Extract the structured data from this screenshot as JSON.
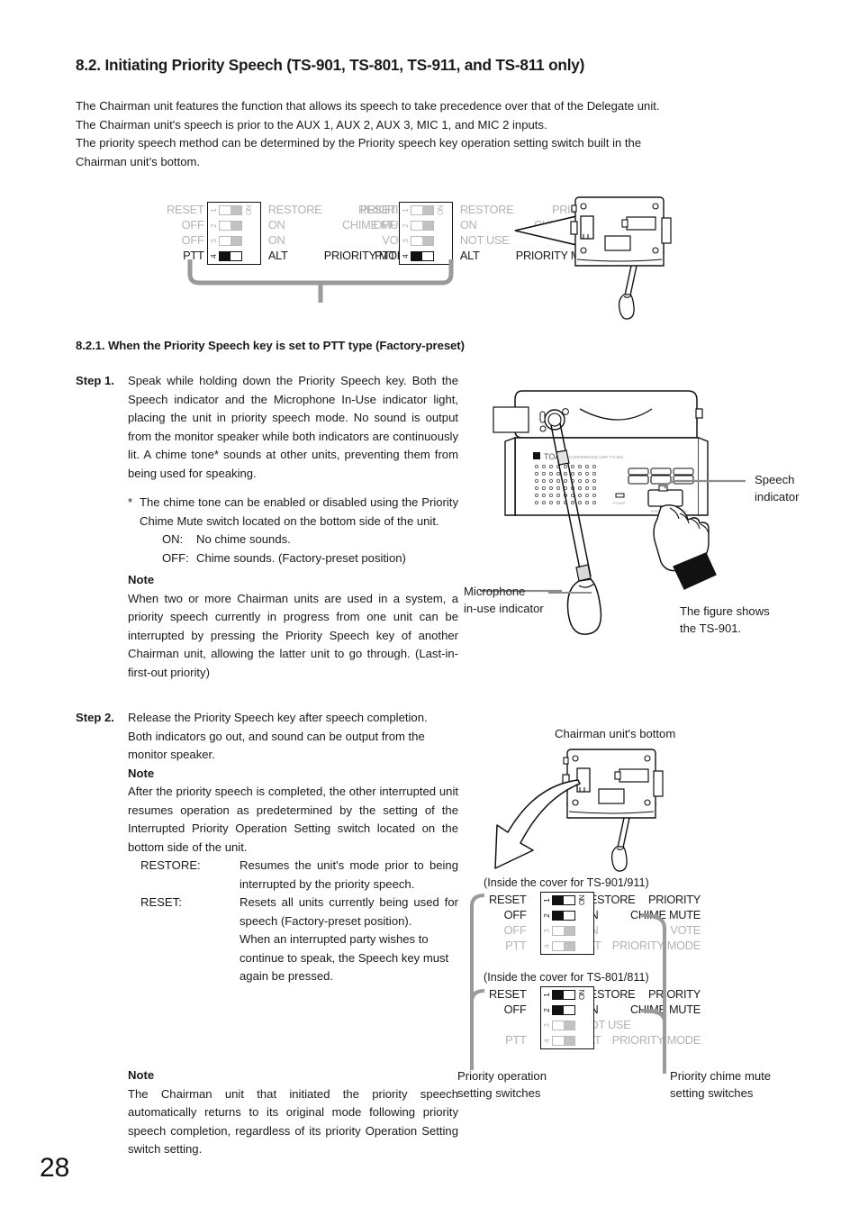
{
  "page": {
    "number": "28"
  },
  "section": {
    "heading": "8.2. Initiating Priority Speech (TS-901, TS-801, TS-911, and TS-811 only)",
    "intro_lines": [
      "The Chairman unit features the function that allows its speech to take precedence over that of the Delegate unit.",
      "The Chairman unit's speech is prior to the AUX 1, AUX 2, AUX 3, MIC 1, and MIC 2 inputs.",
      "The priority speech method can be determined by the Priority speech key operation setting switch built in the",
      "Chairman unit’s bottom."
    ]
  },
  "subsection": {
    "heading": "8.2.1. When the Priority Speech key is set to PTT type (Factory-preset)"
  },
  "step1": {
    "label": "Step 1.",
    "body": "Speak while holding down the Priority Speech key. Both the Speech indicator and the Microphone In-Use indicator light, placing the unit in priority speech mode. No sound is output from the monitor speaker while both indicators are continuously lit. A chime tone* sounds at other units, preventing them from being used for speaking.",
    "footnote_marker": "*",
    "footnote": "The chime tone can be enabled or disabled using the Priority Chime Mute switch located on the bottom side of the unit.",
    "on_key": "ON:",
    "on_value": "No chime sounds.",
    "off_key": "OFF:",
    "off_value": "Chime sounds. (Factory-preset position)",
    "note_heading": "Note",
    "note_body": "When two or more Chairman units are used in a system, a priority speech currently in progress from one unit can be interrupted by pressing the Priority Speech key of another Chairman unit, allowing the latter unit to go through. (Last-in-first-out priority)"
  },
  "step2": {
    "label": "Step 2.",
    "body_line1": "Release the Priority Speech key after speech completion.",
    "body_line2": "Both indicators go out, and sound can be output from the monitor speaker.",
    "note_heading": "Note",
    "note_body": "After the priority speech is completed, the other interrupted unit resumes operation as predetermined by the setting of the Interrupted Priority Operation Setting switch located on the bottom side of the unit.",
    "defs": [
      {
        "key": "RESTORE:",
        "value": "Resumes the unit's mode prior to being interrupted by the priority speech."
      },
      {
        "key": "RESET:",
        "value": "Resets all units currently being used for speech (Factory-preset position)."
      },
      {
        "key": "",
        "value": "When an interrupted party wishes to continue to speak, the Speech key must again be pressed."
      }
    ]
  },
  "final_note": {
    "heading": "Note",
    "body": "The Chairman unit that initiated the priority speech automatically returns to its original mode following priority speech completion, regardless of its priority Operation Setting switch setting."
  },
  "top_figure": {
    "dip_901": {
      "rows": [
        {
          "left": "RESET",
          "right_1": "RESTORE",
          "right_2": "PRIORITY",
          "num": "1",
          "on_label": "ON",
          "position": "right",
          "active": false
        },
        {
          "left": "OFF",
          "right_1": "ON",
          "right_2": "CHIME MUTE",
          "num": "2",
          "on_label": "",
          "position": "right",
          "active": false
        },
        {
          "left": "OFF",
          "right_1": "ON",
          "right_2": "VOTE",
          "num": "3",
          "on_label": "",
          "position": "right",
          "active": false
        },
        {
          "left": "PTT",
          "right_1": "ALT",
          "right_2": "PRIORITY MODE",
          "num": "4",
          "on_label": "",
          "position": "left",
          "active": true
        }
      ]
    },
    "dip_801": {
      "rows": [
        {
          "left": "RESET",
          "right_1": "RESTORE",
          "right_2": "PRIORITY",
          "num": "1",
          "on_label": "ON",
          "position": "right",
          "active": false
        },
        {
          "left": "OFF",
          "right_1": "ON",
          "right_2": "CHIME MUTE",
          "num": "2",
          "on_label": "",
          "position": "right",
          "active": false
        },
        {
          "left": "",
          "right_1": "NOT  USE",
          "right_2": "",
          "num": "3",
          "on_label": "",
          "position": "right",
          "active": false
        },
        {
          "left": "PTT",
          "right_1": "ALT",
          "right_2": "PRIORITY MODE",
          "num": "4",
          "on_label": "",
          "position": "left",
          "active": true
        }
      ]
    }
  },
  "unit_figure": {
    "speech_indicator_label_line1": "Speech",
    "speech_indicator_label_line2": "indicator",
    "mic_label_line1": "Microphone",
    "mic_label_line2": "in-use indicator",
    "caption_line1": "The figure shows",
    "caption_line2": "the TS-901.",
    "brand": "TOA"
  },
  "bottom_figure": {
    "title": "Chairman unit's bottom",
    "cover_901": "(Inside the cover for TS-901/911)",
    "cover_801": "(Inside the cover for TS-801/811)",
    "dip_901": {
      "rows": [
        {
          "left": "RESET",
          "right_1": "RESTORE",
          "right_2": "PRIORITY",
          "num": "1",
          "on_label": "ON",
          "position": "left",
          "active": true
        },
        {
          "left": "OFF",
          "right_1": "ON",
          "right_2": "CHIME MUTE",
          "num": "2",
          "on_label": "",
          "position": "left",
          "active": true
        },
        {
          "left": "OFF",
          "right_1": "ON",
          "right_2": "VOTE",
          "num": "3",
          "on_label": "",
          "position": "right",
          "active": false
        },
        {
          "left": "PTT",
          "right_1": "ALT",
          "right_2": "PRIORITY MODE",
          "num": "4",
          "on_label": "",
          "position": "right",
          "active": false
        }
      ]
    },
    "dip_801": {
      "rows": [
        {
          "left": "RESET",
          "right_1": "RESTORE",
          "right_2": "PRIORITY",
          "num": "1",
          "on_label": "ON",
          "position": "left",
          "active": true
        },
        {
          "left": "OFF",
          "right_1": "ON",
          "right_2": "CHIME MUTE",
          "num": "2",
          "on_label": "",
          "position": "left",
          "active": true
        },
        {
          "left": "",
          "right_1": "NOT  USE",
          "right_2": "",
          "num": "3",
          "on_label": "",
          "position": "right",
          "active": false
        },
        {
          "left": "PTT",
          "right_1": "ALT",
          "right_2": "PRIORITY MODE",
          "num": "4",
          "on_label": "",
          "position": "right",
          "active": false
        }
      ]
    },
    "legend_left_line1": "Priority operation",
    "legend_left_line2": "setting switches",
    "legend_right_line1": "Priority chime mute",
    "legend_right_line2": "setting switches"
  },
  "colors": {
    "ink": "#1a1a1a",
    "dim": "#b3b3b3",
    "grey_bracket": "#9a9a9a"
  }
}
